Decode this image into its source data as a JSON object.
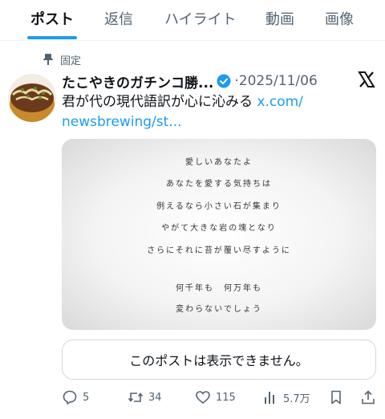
{
  "tabs": [
    "ポスト",
    "返信",
    "ハイライト",
    "動画",
    "画像"
  ],
  "pinned_label": "固定",
  "tweet": {
    "author": "たこやきのガチンコ勝...",
    "date_sep": "·",
    "date": "2025/11/06",
    "text": "君が代の現代語訳が心に沁みる",
    "link_part1": "x.com/",
    "link_part2": "newsbrewing/st..."
  },
  "poem": [
    "愛しいあなたよ",
    "あなたを愛する気持ちは",
    "例えるなら小さい石が集まり",
    "やがて大きな岩の塊となり",
    "さらにそれに苔が覆い尽すように",
    "何千年も　何万年も",
    "変わらないでしょう"
  ],
  "quote_unavailable": "このポストは表示できません。",
  "stats": {
    "replies": "5",
    "reposts": "34",
    "likes": "115",
    "views": "5.7万"
  },
  "colors": {
    "accent": "#1d9bf0",
    "text": "#0f1419",
    "muted": "#536471",
    "border": "#cfd9de"
  },
  "icons": [
    "pin-icon",
    "verified-badge-icon",
    "x-logo-icon",
    "reply-icon",
    "repost-icon",
    "like-icon",
    "views-icon",
    "bookmark-icon",
    "share-icon"
  ]
}
